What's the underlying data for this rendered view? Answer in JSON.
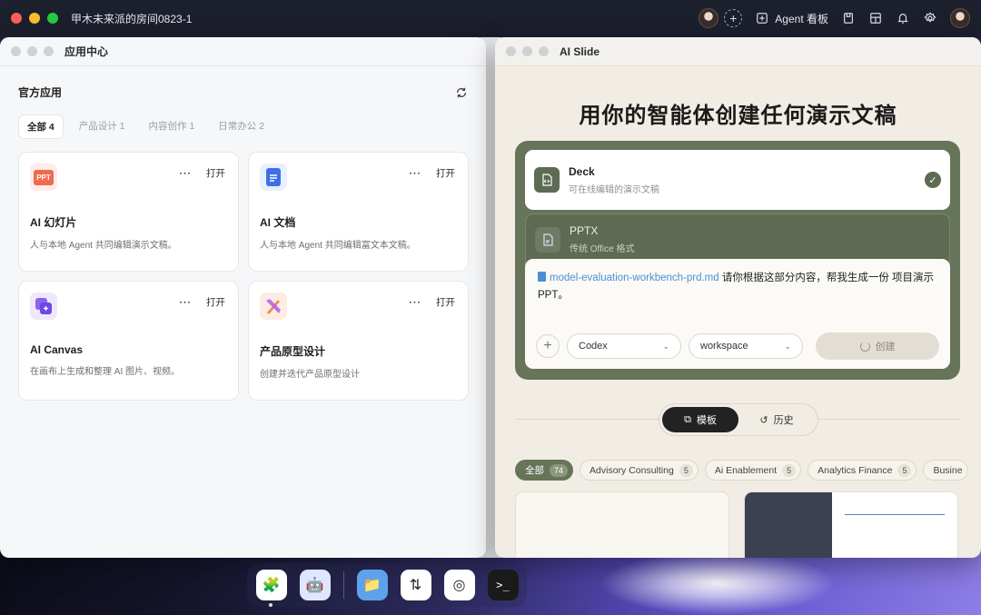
{
  "window": {
    "title": "甲木未来派的房间0823-1"
  },
  "topbar": {
    "agent_board_label": "Agent 看板"
  },
  "app_center": {
    "title": "应用中心",
    "section_title": "官方应用",
    "tabs": [
      {
        "label": "全部 4"
      },
      {
        "label": "产品设计 1"
      },
      {
        "label": "内容创作 1"
      },
      {
        "label": "日常办公 2"
      }
    ],
    "open_label": "打开",
    "more_label": "···",
    "apps": [
      {
        "title": "AI 幻灯片",
        "desc": "人与本地 Agent 共同编辑演示文稿。",
        "icon_text": "PPT"
      },
      {
        "title": "AI 文档",
        "desc": "人与本地 Agent 共同编辑富文本文稿。"
      },
      {
        "title": "AI Canvas",
        "desc": "在画布上生成和整理 AI 图片、视频。"
      },
      {
        "title": "产品原型设计",
        "desc": "创建并迭代产品原型设计"
      }
    ]
  },
  "ai_slide": {
    "title": "AI Slide",
    "hero": "用你的智能体创建任何演示文稿",
    "options": [
      {
        "title": "Deck",
        "sub": "可在线编辑的演示文稿"
      },
      {
        "title": "PPTX",
        "sub": "传统 Office 格式"
      }
    ],
    "prompt_file": "model-evaluation-workbench-prd.md",
    "prompt_text": "请你根据这部分内容，帮我生成一份 项目演示 PPT。",
    "agent_select": "Codex",
    "workspace_select": "workspace",
    "create_label": "创建",
    "switch": {
      "templates": "模板",
      "history": "历史"
    },
    "chips": [
      {
        "label": "全部",
        "count": "74"
      },
      {
        "label": "Advisory Consulting",
        "count": "5"
      },
      {
        "label": "Ai Enablement",
        "count": "5"
      },
      {
        "label": "Analytics Finance",
        "count": "5"
      },
      {
        "label": "Busine"
      }
    ]
  },
  "colors": {
    "accent": "#66745a",
    "topbar": "#1c1f2c"
  }
}
